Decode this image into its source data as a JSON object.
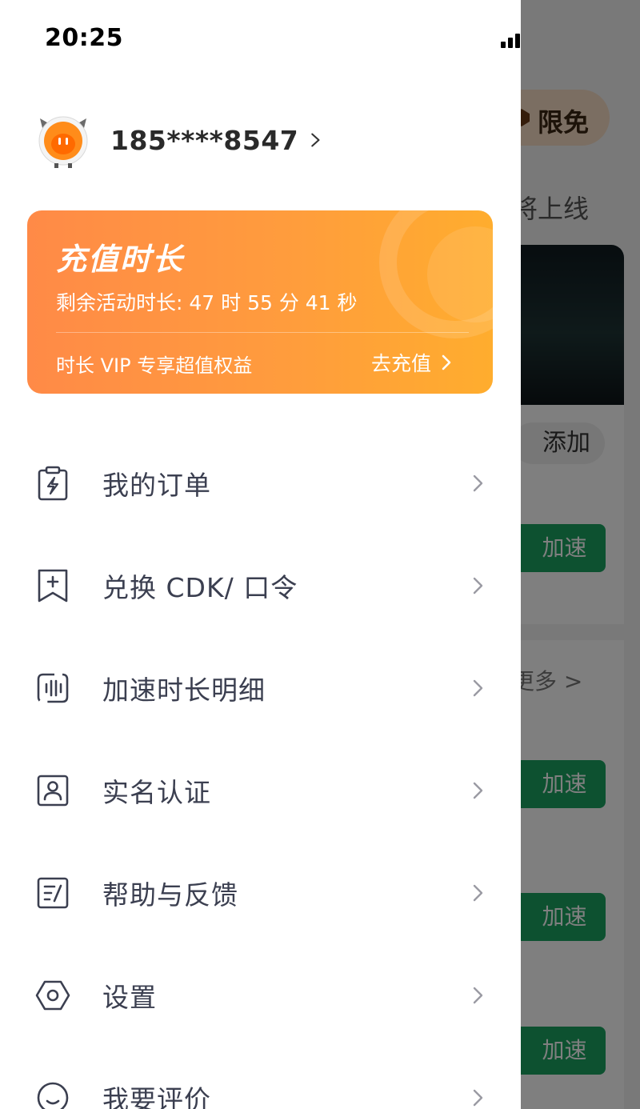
{
  "status_bar": {
    "time": "20:25"
  },
  "background": {
    "free_badge": "限免",
    "online_text": "将上线",
    "add_button": "添加",
    "more_link": "更多 >",
    "accelerate_buttons": [
      "加速",
      "加速",
      "加速",
      "加速"
    ]
  },
  "drawer": {
    "profile": {
      "phone": "185****8547"
    },
    "vip_card": {
      "title": "充值时长",
      "remaining": "剩余活动时长: 47 时 55 分 41 秒",
      "benefit": "时长 VIP 专享超值权益",
      "action": "去充值"
    },
    "menu": [
      {
        "label": "我的订单",
        "icon": "clipboard-bolt-icon"
      },
      {
        "label": "兑换 CDK/ 口令",
        "icon": "bookmark-plus-icon"
      },
      {
        "label": "加速时长明细",
        "icon": "audio-bars-icon"
      },
      {
        "label": "实名认证",
        "icon": "id-user-icon"
      },
      {
        "label": "帮助与反馈",
        "icon": "feedback-doc-icon"
      },
      {
        "label": "设置",
        "icon": "hexagon-gear-icon"
      },
      {
        "label": "我要评价",
        "icon": "smile-face-icon"
      }
    ]
  },
  "colors": {
    "vip_gradient_start": "#ff8a47",
    "vip_gradient_end": "#ffad2e",
    "menu_text": "#3b3f50",
    "accelerate_green": "#1aa260"
  }
}
